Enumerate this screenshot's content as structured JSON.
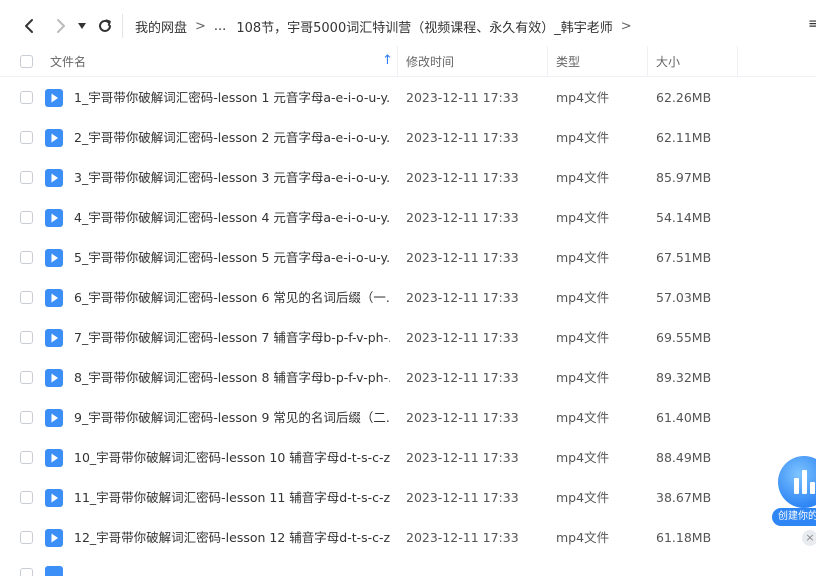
{
  "nav": {
    "back_icon": "chevron-left-icon",
    "forward_icon": "chevron-right-icon",
    "dropdown_icon": "caret-down-icon",
    "refresh_icon": "refresh-icon"
  },
  "breadcrumb": {
    "root": "我的网盘",
    "ellipsis": "...",
    "current": "108节，宇哥5000词汇特训营（视频课程、永久有效）_韩宇老师",
    "separator": ">",
    "right_cut_char": "≡"
  },
  "columns": {
    "name": "文件名",
    "modified": "修改时间",
    "type": "类型",
    "size": "大小"
  },
  "colors": {
    "accent": "#2f7bf5",
    "file_icon": "#3b8ff6"
  },
  "files": [
    {
      "name": "1_宇哥带你破解词汇密码-lesson 1 元音字母a-e-i-o-u-y...",
      "modified": "2023-12-11 17:33",
      "type": "mp4文件",
      "size": "62.26MB"
    },
    {
      "name": "2_宇哥带你破解词汇密码-lesson 2 元音字母a-e-i-o-u-y...",
      "modified": "2023-12-11 17:33",
      "type": "mp4文件",
      "size": "62.11MB"
    },
    {
      "name": "3_宇哥带你破解词汇密码-lesson 3 元音字母a-e-i-o-u-y...",
      "modified": "2023-12-11 17:33",
      "type": "mp4文件",
      "size": "85.97MB"
    },
    {
      "name": "4_宇哥带你破解词汇密码-lesson 4 元音字母a-e-i-o-u-y...",
      "modified": "2023-12-11 17:33",
      "type": "mp4文件",
      "size": "54.14MB"
    },
    {
      "name": "5_宇哥带你破解词汇密码-lesson 5 元音字母a-e-i-o-u-y...",
      "modified": "2023-12-11 17:33",
      "type": "mp4文件",
      "size": "67.51MB"
    },
    {
      "name": "6_宇哥带你破解词汇密码-lesson 6  常见的名词后缀（一...",
      "modified": "2023-12-11 17:33",
      "type": "mp4文件",
      "size": "57.03MB"
    },
    {
      "name": "7_宇哥带你破解词汇密码-lesson 7 辅音字母b-p-f-v-ph-...",
      "modified": "2023-12-11 17:33",
      "type": "mp4文件",
      "size": "69.55MB"
    },
    {
      "name": "8_宇哥带你破解词汇密码-lesson 8 辅音字母b-p-f-v-ph-...",
      "modified": "2023-12-11 17:33",
      "type": "mp4文件",
      "size": "89.32MB"
    },
    {
      "name": "9_宇哥带你破解词汇密码-lesson 9 常见的名词后缀（二...",
      "modified": "2023-12-11 17:33",
      "type": "mp4文件",
      "size": "61.40MB"
    },
    {
      "name": "10_宇哥带你破解词汇密码-lesson 10 辅音字母d-t-s-c-z...",
      "modified": "2023-12-11 17:33",
      "type": "mp4文件",
      "size": "88.49MB"
    },
    {
      "name": "11_宇哥带你破解词汇密码-lesson 11 辅音字母d-t-s-c-z...",
      "modified": "2023-12-11 17:33",
      "type": "mp4文件",
      "size": "38.67MB"
    },
    {
      "name": "12_宇哥带你破解词汇密码-lesson 12 辅音字母d-t-s-c-z...",
      "modified": "2023-12-11 17:33",
      "type": "mp4文件",
      "size": "61.18MB"
    }
  ],
  "float_widget": {
    "label": "创建你的",
    "icon": "bar-chart-icon",
    "close_icon": "close-icon"
  }
}
